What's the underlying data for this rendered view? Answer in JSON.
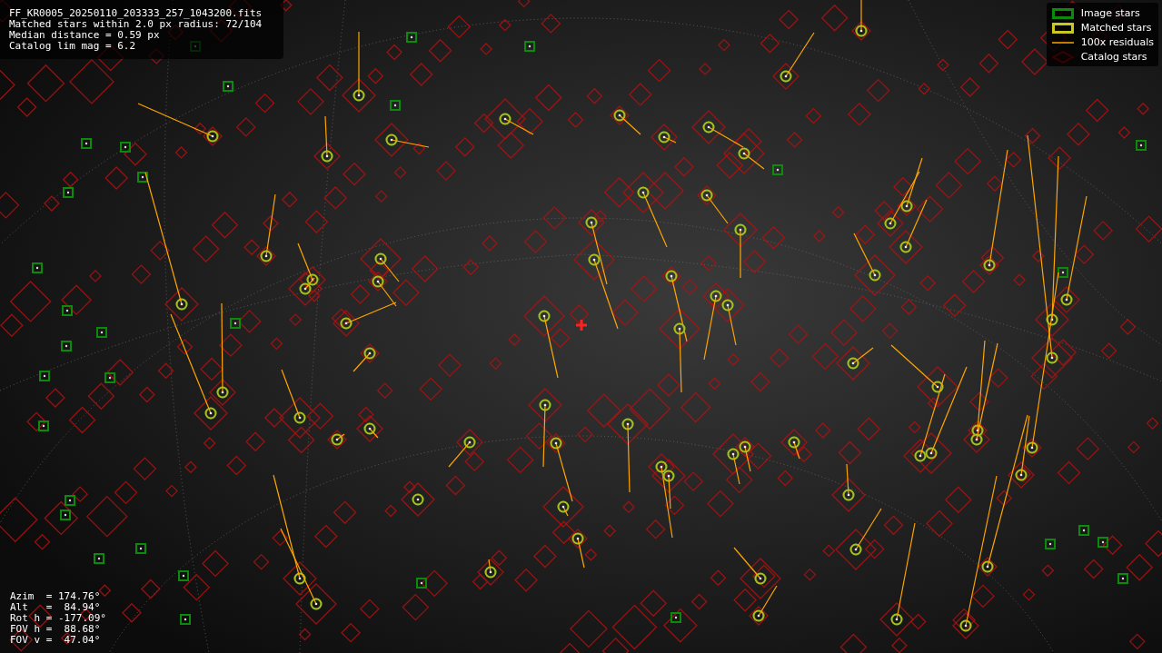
{
  "info": {
    "lines": [
      "FF_KR0005_20250110_203333_257_1043200.fits",
      "Matched stars within 2.0 px radius: 72/104",
      "Median distance = 0.59 px",
      "Catalog lim mag = 6.2"
    ]
  },
  "legend": [
    {
      "kind": "image",
      "label": "Image stars"
    },
    {
      "kind": "matched",
      "label": "Matched stars"
    },
    {
      "kind": "residual",
      "label": "100x residuals"
    },
    {
      "kind": "catalog",
      "label": "Catalog stars"
    }
  ],
  "pointing": [
    "Azim  = 174.76°",
    "Alt   =  84.94°",
    "Rot h = -177.09°",
    "FOV h =  88.68°",
    "FOV v =  47.04°"
  ]
}
